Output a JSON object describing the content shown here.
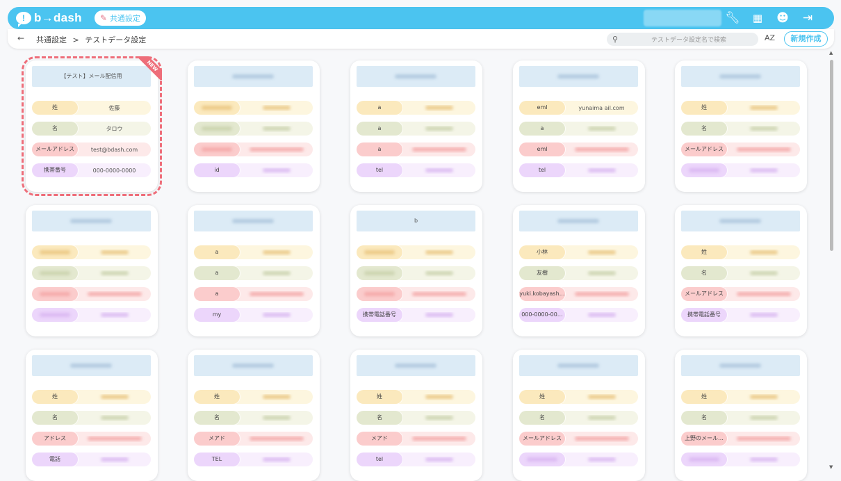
{
  "app": {
    "logo": "b→dash",
    "section_chip": "共通設定"
  },
  "breadcrumb": {
    "root": "共通設定",
    "sep": ">",
    "current": "テストデータ設定"
  },
  "search": {
    "placeholder": "テストデータ設定名で検索"
  },
  "sort_label": "AZ",
  "new_button": "新規作成",
  "new_badge": "NEW",
  "colors": {
    "accent": "#4bc4f0",
    "highlight": "#ee6e7a"
  },
  "cards": [
    {
      "title": "【テスト】メール配信用",
      "rows": [
        {
          "label": "姓",
          "value": "佐藤"
        },
        {
          "label": "名",
          "value": "タロウ"
        },
        {
          "label": "メールアドレス",
          "value": "test@bdash.com"
        },
        {
          "label": "携帯番号",
          "value": "000-0000-0000"
        }
      ]
    },
    {
      "title": "",
      "rows": [
        {
          "label": "",
          "value": ""
        },
        {
          "label": "",
          "value": ""
        },
        {
          "label": "",
          "value": ""
        },
        {
          "label": "id",
          "value": ""
        }
      ]
    },
    {
      "title": "",
      "rows": [
        {
          "label": "a",
          "value": ""
        },
        {
          "label": "a",
          "value": ""
        },
        {
          "label": "a",
          "value": ""
        },
        {
          "label": "tel",
          "value": ""
        }
      ]
    },
    {
      "title": "",
      "rows": [
        {
          "label": "eml",
          "value": "yunaima                ail.com"
        },
        {
          "label": "a",
          "value": ""
        },
        {
          "label": "eml",
          "value": ""
        },
        {
          "label": "tel",
          "value": ""
        }
      ]
    },
    {
      "title": "",
      "rows": [
        {
          "label": "姓",
          "value": ""
        },
        {
          "label": "名",
          "value": ""
        },
        {
          "label": "メールアドレス",
          "value": ""
        },
        {
          "label": "",
          "value": ""
        }
      ]
    },
    {
      "title": "",
      "rows": [
        {
          "label": "",
          "value": ""
        },
        {
          "label": "",
          "value": ""
        },
        {
          "label": "",
          "value": ""
        },
        {
          "label": "",
          "value": ""
        }
      ]
    },
    {
      "title": "",
      "rows": [
        {
          "label": "a",
          "value": ""
        },
        {
          "label": "a",
          "value": ""
        },
        {
          "label": "a",
          "value": ""
        },
        {
          "label": "my",
          "value": ""
        }
      ]
    },
    {
      "title": "b",
      "rows": [
        {
          "label": "",
          "value": ""
        },
        {
          "label": "",
          "value": ""
        },
        {
          "label": "",
          "value": ""
        },
        {
          "label": "携帯電話番号",
          "value": ""
        }
      ]
    },
    {
      "title": "",
      "rows": [
        {
          "label": "小林",
          "value": ""
        },
        {
          "label": "友樹",
          "value": ""
        },
        {
          "label": "yuki.kobayash…",
          "value": ""
        },
        {
          "label": "000-0000-00…",
          "value": ""
        }
      ]
    },
    {
      "title": "",
      "rows": [
        {
          "label": "姓",
          "value": ""
        },
        {
          "label": "名",
          "value": ""
        },
        {
          "label": "メールアドレス",
          "value": ""
        },
        {
          "label": "携帯電話番号",
          "value": ""
        }
      ]
    },
    {
      "title": "",
      "rows": [
        {
          "label": "姓",
          "value": ""
        },
        {
          "label": "名",
          "value": ""
        },
        {
          "label": "アドレス",
          "value": ""
        },
        {
          "label": "電話",
          "value": ""
        }
      ]
    },
    {
      "title": "",
      "rows": [
        {
          "label": "姓",
          "value": ""
        },
        {
          "label": "名",
          "value": ""
        },
        {
          "label": "メアド",
          "value": ""
        },
        {
          "label": "TEL",
          "value": ""
        }
      ]
    },
    {
      "title": "",
      "rows": [
        {
          "label": "姓",
          "value": ""
        },
        {
          "label": "名",
          "value": ""
        },
        {
          "label": "メアド",
          "value": ""
        },
        {
          "label": "tel",
          "value": ""
        }
      ]
    },
    {
      "title": "",
      "rows": [
        {
          "label": "姓",
          "value": ""
        },
        {
          "label": "名",
          "value": ""
        },
        {
          "label": "メールアドレス",
          "value": ""
        },
        {
          "label": "",
          "value": ""
        }
      ]
    },
    {
      "title": "",
      "rows": [
        {
          "label": "姓",
          "value": ""
        },
        {
          "label": "名",
          "value": ""
        },
        {
          "label": "上野のメール…",
          "value": ""
        },
        {
          "label": "",
          "value": ""
        }
      ]
    }
  ]
}
